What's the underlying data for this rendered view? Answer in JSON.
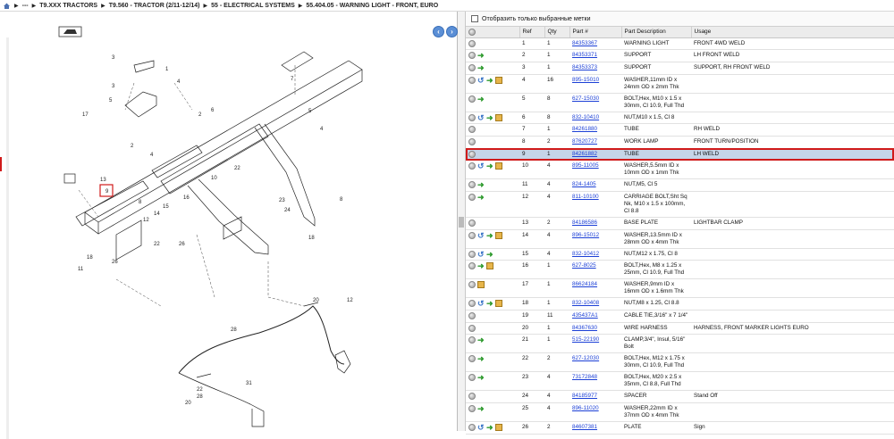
{
  "breadcrumb": {
    "items": [
      "---",
      "T9.XXX TRACTORS",
      "T9.560 - TRACTOR (2/11-12/14)",
      "55 - ELECTRICAL SYSTEMS",
      "55.404.05 - WARNING LIGHT - FRONT, EURO"
    ]
  },
  "filter": {
    "label": "Отобразить только выбранные метки"
  },
  "columns": [
    "Ref",
    "Qty",
    "Part #",
    "Part Description",
    "Usage"
  ],
  "rows": [
    {
      "ref": "1",
      "qty": "1",
      "part": "84353367",
      "desc": "WARNING LIGHT",
      "usage": "FRONT 4WD WELD",
      "icons": [
        "c"
      ]
    },
    {
      "ref": "2",
      "qty": "1",
      "part": "84353371",
      "desc": "SUPPORT",
      "usage": "LH FRONT WELD",
      "icons": [
        "c",
        "g"
      ]
    },
    {
      "ref": "3",
      "qty": "1",
      "part": "84353373",
      "desc": "SUPPORT",
      "usage": "SUPPORT, RH FRONT WELD",
      "icons": [
        "c",
        "g"
      ]
    },
    {
      "ref": "4",
      "qty": "16",
      "part": "895-15010",
      "desc": "WASHER,11mm ID x 24mm OD x 2mm Thk",
      "usage": "",
      "icons": [
        "c",
        "b",
        "g",
        "x"
      ]
    },
    {
      "ref": "5",
      "qty": "8",
      "part": "627-15030",
      "desc": "BOLT,Hex, M10 x 1.5 x 30mm, Cl 10.9, Full Thd",
      "usage": "",
      "icons": [
        "c",
        "g"
      ]
    },
    {
      "ref": "6",
      "qty": "8",
      "part": "832-10410",
      "desc": "NUT,M10 x 1.5, Cl 8",
      "usage": "",
      "icons": [
        "c",
        "b",
        "g",
        "x"
      ]
    },
    {
      "ref": "7",
      "qty": "1",
      "part": "84261880",
      "desc": "TUBE",
      "usage": "RH WELD",
      "icons": [
        "c"
      ]
    },
    {
      "ref": "8",
      "qty": "2",
      "part": "87620727",
      "desc": "WORK LAMP",
      "usage": "FRONT TURN/POSITION",
      "icons": [
        "c"
      ]
    },
    {
      "ref": "9",
      "qty": "1",
      "part": "84261882",
      "desc": "TUBE",
      "usage": "LH WELD",
      "icons": [
        "c"
      ],
      "selected": true
    },
    {
      "ref": "10",
      "qty": "4",
      "part": "895-11005",
      "desc": "WASHER,5.5mm ID x 10mm OD x 1mm Thk",
      "usage": "",
      "icons": [
        "c",
        "b",
        "g",
        "x"
      ]
    },
    {
      "ref": "11",
      "qty": "4",
      "part": "824-1405",
      "desc": "NUT,M5, Cl 5",
      "usage": "",
      "icons": [
        "c",
        "g"
      ]
    },
    {
      "ref": "12",
      "qty": "4",
      "part": "811-10100",
      "desc": "CARRIAGE BOLT,Sht Sq Nk, M10 x 1.5 x 100mm, Cl 8.8",
      "usage": "",
      "icons": [
        "c",
        "g"
      ]
    },
    {
      "ref": "13",
      "qty": "2",
      "part": "84186586",
      "desc": "BASE PLATE",
      "usage": "LIGHTBAR CLAMP",
      "icons": [
        "c"
      ]
    },
    {
      "ref": "14",
      "qty": "4",
      "part": "896-15012",
      "desc": "WASHER,13.5mm ID x 28mm OD x 4mm Thk",
      "usage": "",
      "icons": [
        "c",
        "b",
        "g",
        "x"
      ]
    },
    {
      "ref": "15",
      "qty": "4",
      "part": "832-10412",
      "desc": "NUT,M12 x 1.75, Cl 8",
      "usage": "",
      "icons": [
        "c",
        "b",
        "g"
      ]
    },
    {
      "ref": "16",
      "qty": "1",
      "part": "627-8025",
      "desc": "BOLT,Hex, M8 x 1.25 x 25mm, Cl 10.9, Full Thd",
      "usage": "",
      "icons": [
        "c",
        "g",
        "x"
      ]
    },
    {
      "ref": "17",
      "qty": "1",
      "part": "86624184",
      "desc": "WASHER,9mm ID x 16mm OD x 1.6mm Thk",
      "usage": "",
      "icons": [
        "c",
        "x"
      ]
    },
    {
      "ref": "18",
      "qty": "1",
      "part": "832-10408",
      "desc": "NUT,M8 x 1.25, Cl 8.8",
      "usage": "",
      "icons": [
        "c",
        "b",
        "g",
        "x"
      ]
    },
    {
      "ref": "19",
      "qty": "11",
      "part": "435437A1",
      "desc": "CABLE TIE,3/16\" x 7 1/4\"",
      "usage": "",
      "icons": [
        "c"
      ]
    },
    {
      "ref": "20",
      "qty": "1",
      "part": "84367630",
      "desc": "WIRE HARNESS",
      "usage": "HARNESS, FRONT MARKER LIGHTS EURO",
      "icons": [
        "c"
      ]
    },
    {
      "ref": "21",
      "qty": "1",
      "part": "515-22190",
      "desc": "CLAMP,3/4\", Insul, 5/16\" Bolt",
      "usage": "",
      "icons": [
        "c",
        "g"
      ]
    },
    {
      "ref": "22",
      "qty": "2",
      "part": "627-12030",
      "desc": "BOLT,Hex, M12 x 1.75 x 30mm, Cl 10.9, Full Thd",
      "usage": "",
      "icons": [
        "c",
        "g"
      ]
    },
    {
      "ref": "23",
      "qty": "4",
      "part": "73172848",
      "desc": "BOLT,Hex, M20 x 2.5 x 35mm, Cl 8.8, Full Thd",
      "usage": "",
      "icons": [
        "c",
        "g"
      ]
    },
    {
      "ref": "24",
      "qty": "4",
      "part": "84185977",
      "desc": "SPACER",
      "usage": "Stand Off",
      "icons": [
        "c"
      ]
    },
    {
      "ref": "25",
      "qty": "4",
      "part": "896-11020",
      "desc": "WASHER,22mm ID x 37mm OD x 4mm Thk",
      "usage": "",
      "icons": [
        "c",
        "g"
      ]
    },
    {
      "ref": "26",
      "qty": "2",
      "part": "84607381",
      "desc": "PLATE",
      "usage": "Sign",
      "icons": [
        "c",
        "b",
        "g",
        "x"
      ]
    }
  ],
  "diagram_labels": [
    "1",
    "2",
    "3",
    "4",
    "5",
    "6",
    "7",
    "8",
    "9",
    "10",
    "11",
    "12",
    "13",
    "14",
    "15",
    "16",
    "17",
    "18",
    "19",
    "20",
    "21",
    "22",
    "23",
    "24",
    "25",
    "26",
    "27",
    "28",
    "29",
    "30",
    "31"
  ]
}
